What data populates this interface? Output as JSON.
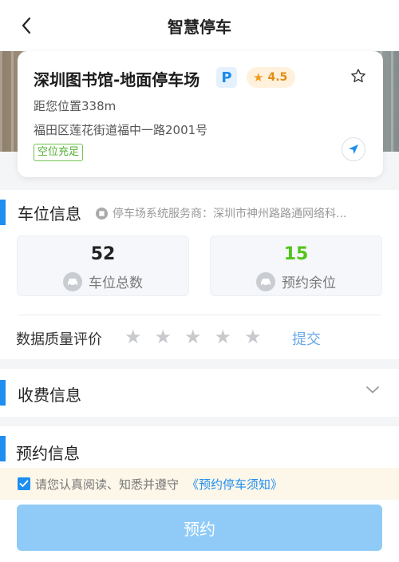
{
  "header": {
    "title": "智慧停车",
    "back_icon": "chevron-left-icon"
  },
  "parking_lot": {
    "name": "深圳图书馆-地面停车场",
    "p_badge": "P",
    "rating": "4.5",
    "distance": "距您位置338m",
    "address": "福田区莲花街道福中一路2001号",
    "status_tag": "空位充足",
    "favorite_icon": "star-outline-icon",
    "navigate_icon": "navigation-arrow-icon"
  },
  "space_info": {
    "title": "车位信息",
    "provider": "停车场系统服务商：深圳市神州路路通网络科...",
    "total": {
      "value": "52",
      "label": "车位总数",
      "color": "#222222"
    },
    "available": {
      "value": "15",
      "label": "预约余位",
      "color": "#52c41a"
    },
    "quality_label": "数据质量评价",
    "rating_stars": 5,
    "submit_label": "提交"
  },
  "fee_info": {
    "title": "收费信息",
    "expand_icon": "chevron-down-icon"
  },
  "booking_info": {
    "title": "预约信息",
    "agree_text": "请您认真阅读、知悉并遵守",
    "notice_link": "《预约停车须知》",
    "agreed": true,
    "submit_label": "预约"
  },
  "colors": {
    "accent": "#1e8ef0",
    "success": "#52c41a",
    "rating": "#f29c1f"
  }
}
